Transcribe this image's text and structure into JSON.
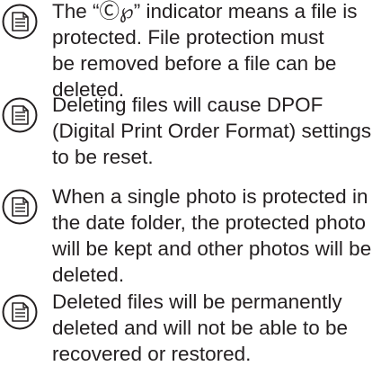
{
  "notes": [
    {
      "icon": "memo-note-icon",
      "lines": [
        "The “Ⓒ℘” indicator means a file is",
        "protected. File protection must",
        "be removed before a file can be",
        "deleted."
      ]
    },
    {
      "icon": "memo-note-icon",
      "lines": [
        "Deleting files will cause DPOF",
        "(Digital Print Order Format) settings",
        "to be reset."
      ]
    },
    {
      "icon": "memo-note-icon",
      "lines": [
        "When a single photo is protected in",
        "the date folder, the protected photo",
        "will be kept and other photos will be",
        "deleted."
      ]
    },
    {
      "icon": "memo-note-icon",
      "lines": [
        "Deleted files will be permanently",
        "deleted and will not be able to be",
        "recovered or restored."
      ]
    }
  ]
}
